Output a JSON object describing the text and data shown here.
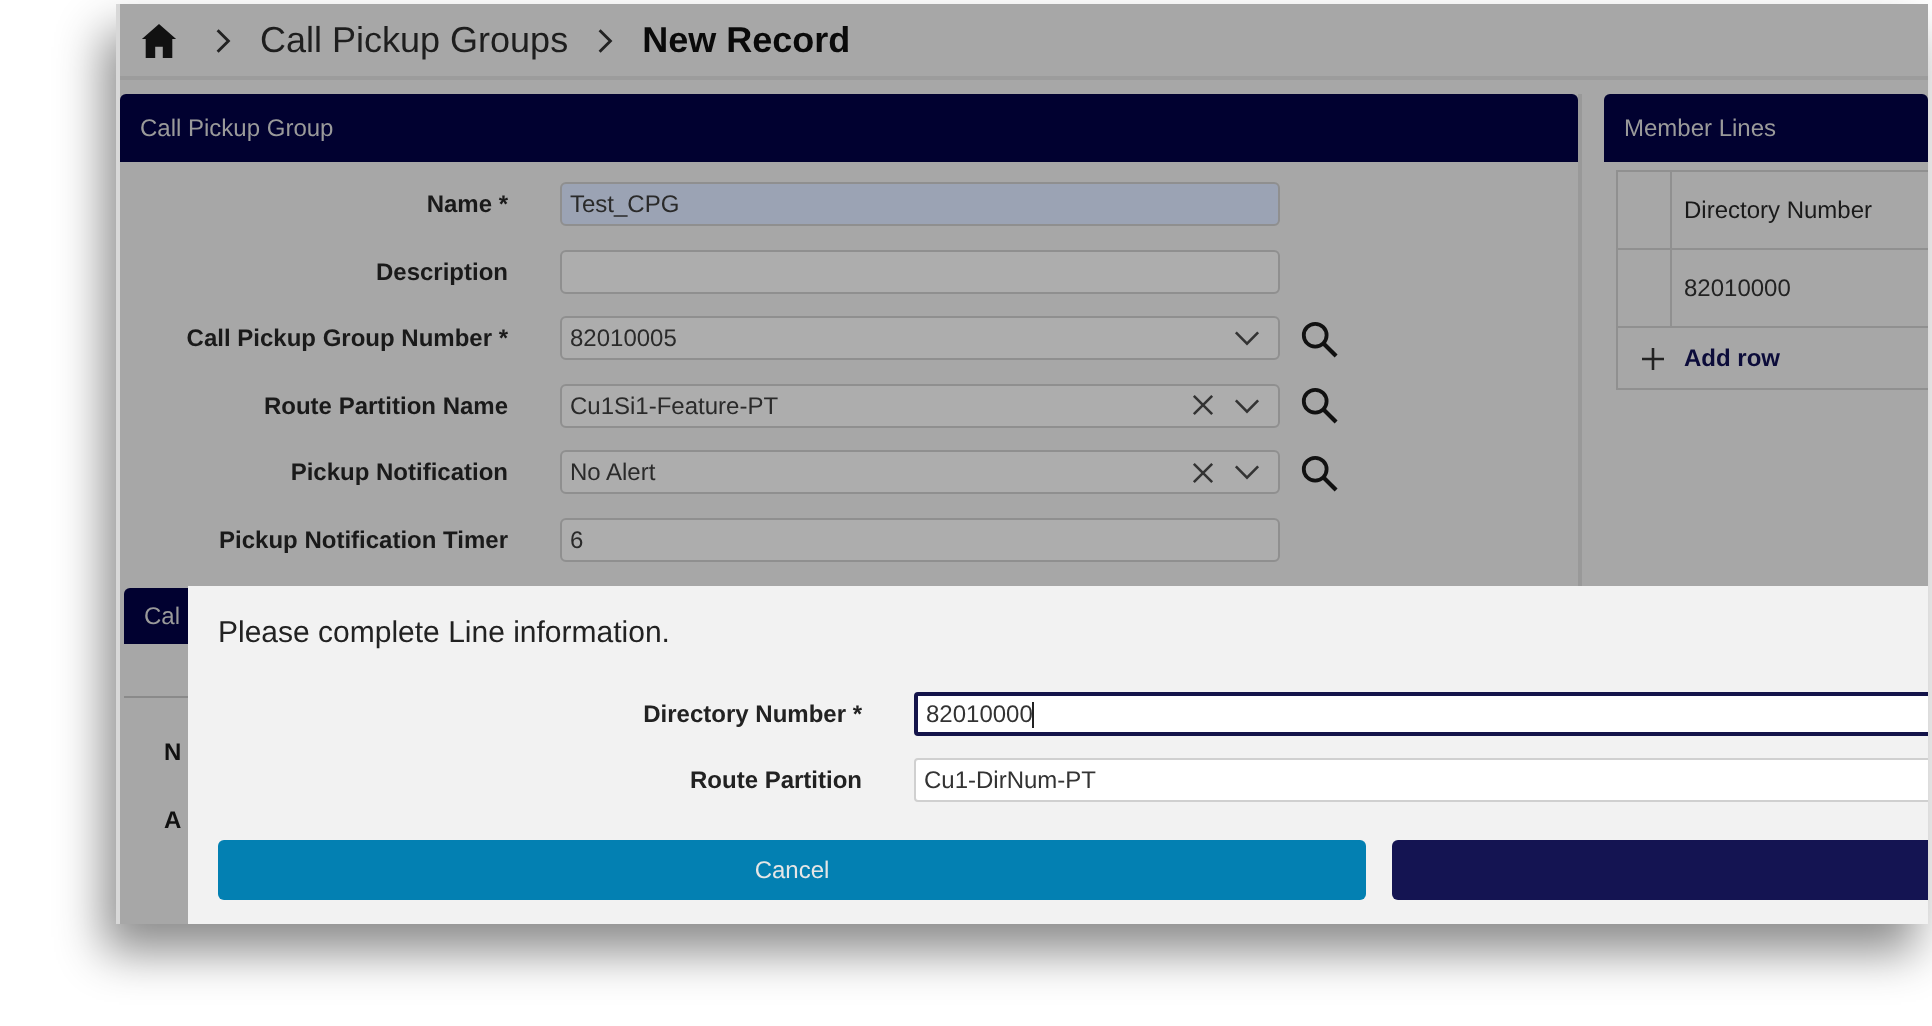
{
  "breadcrumb": [
    {
      "label": "Call Pickup Groups",
      "current": false
    },
    {
      "label": "New Record",
      "current": true
    }
  ],
  "panel": {
    "title": "Call Pickup Group",
    "fields": [
      {
        "label": "Name *",
        "value": "Test_CPG",
        "kind": "text",
        "highlighted": true,
        "clearable": false,
        "search": false
      },
      {
        "label": "Description",
        "kind": "text",
        "highlighted": false,
        "clearable": false,
        "search": false
      },
      {
        "label": "Call Pickup Group Number *",
        "value": "82010005",
        "kind": "select",
        "highlighted": false,
        "clearable": false,
        "search": true
      },
      {
        "label": "Route Partition Name",
        "value": "Cu1Si1-Feature-PT",
        "kind": "select",
        "highlighted": false,
        "clearable": true,
        "search": true
      },
      {
        "label": "Pickup Notification",
        "value": "No Alert",
        "kind": "select",
        "highlighted": false,
        "clearable": true,
        "search": true
      },
      {
        "label": "Pickup Notification Timer",
        "value": "6",
        "kind": "text",
        "highlighted": false,
        "clearable": false,
        "search": false
      }
    ]
  },
  "lower_panel": {
    "title": "Cal",
    "labels": [
      "N",
      "A"
    ]
  },
  "member_lines": {
    "title": "Member Lines",
    "columns": [
      "Directory Number"
    ],
    "rows": [
      [
        "82010000"
      ]
    ],
    "add_label": "Add row"
  },
  "dialog": {
    "message": "Please complete Line information.",
    "fields": [
      {
        "label": "Directory Number *",
        "value": "82010000",
        "focused": true
      },
      {
        "label": "Route Partition",
        "value": "Cu1-DirNum-PT",
        "focused": false
      }
    ],
    "buttons": [
      {
        "label": "Cancel",
        "kind": "secondary"
      },
      {
        "kind": "primary"
      }
    ]
  }
}
